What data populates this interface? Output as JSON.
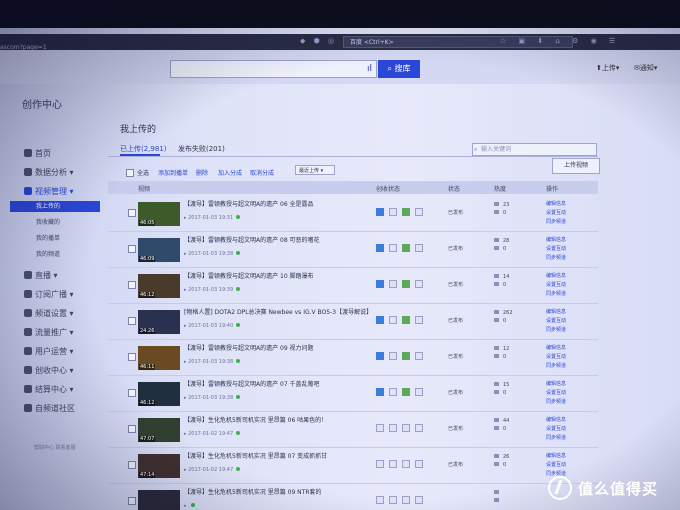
{
  "browser": {
    "url": "ascom?page=1",
    "search_box": "百度 <Ctrl+K>"
  },
  "header": {
    "search_button": "搜库",
    "upload": "上传",
    "notice": "通知"
  },
  "sidebar": {
    "title": "创作中心",
    "items": [
      {
        "label": "首页"
      },
      {
        "label": "数据分析"
      },
      {
        "label": "视频管理"
      },
      {
        "label": "直播"
      },
      {
        "label": "订阅广播"
      },
      {
        "label": "频道设置"
      },
      {
        "label": "流量推广"
      },
      {
        "label": "用户运营"
      },
      {
        "label": "创收中心"
      },
      {
        "label": "结算中心"
      },
      {
        "label": "自频道社区"
      }
    ],
    "sub_items": [
      {
        "label": "我上传的"
      },
      {
        "label": "我收藏的"
      },
      {
        "label": "我的播单"
      },
      {
        "label": "我的频道"
      }
    ],
    "footer": "帮助中心  联系客服"
  },
  "main": {
    "page_title": "我上传的",
    "search_placeholder": "输入关键词",
    "tabs": [
      {
        "label": "已上传(2,981)"
      },
      {
        "label": "发布失败(201)"
      }
    ],
    "toolbar": {
      "select_all": "全选",
      "add_to_playlist": "添加到播单",
      "delete": "删除",
      "add_category": "加入分成",
      "cancel_category": "取消分成",
      "sort": "最近上传",
      "upload_video": "上传视频"
    },
    "columns": {
      "video": "视频",
      "revenue_status": "创收状态",
      "status": "状态",
      "heat": "热度",
      "actions": "操作"
    },
    "rows": [
      {
        "duration": "46:05",
        "title": "【渡导】雷顿教授与超文明A的遗产 06 全是露品",
        "date": "2017-01-03 19:31",
        "status": "已发布",
        "heat": [
          "23",
          "0"
        ],
        "ops": [
          "编辑信息",
          "设置互动",
          "同步频道"
        ]
      },
      {
        "duration": "46:09",
        "title": "【渡导】雷顿教授与超文明A的遗产 08 可恶的嗜花",
        "date": "2017-01-03 19:38",
        "status": "已发布",
        "heat": [
          "28",
          "0"
        ],
        "ops": [
          "编辑信息",
          "设置互动",
          "同步频道"
        ]
      },
      {
        "duration": "46:12",
        "title": "【渡导】雷顿教授与超文明A的遗产 10 脚踏瀑布",
        "date": "2017-01-03 19:39",
        "status": "已发布",
        "heat": [
          "14",
          "0"
        ],
        "ops": [
          "编辑信息",
          "设置互动",
          "同步频道"
        ]
      },
      {
        "duration": "24:26",
        "title": "[物格人置] DOTA2 DPL总决赛 Newbee vs IG.V BO5-3【渡导解说】",
        "date": "2017-01-03 19:40",
        "status": "已发布",
        "heat": [
          "262",
          "0"
        ],
        "ops": [
          "编辑信息",
          "设置互动",
          "同步频道"
        ]
      },
      {
        "duration": "46:11",
        "title": "【渡导】雷顿教授与超文明A的遗产 09 视力问题",
        "date": "2017-01-03 19:38",
        "status": "已发布",
        "heat": [
          "12",
          "0"
        ],
        "ops": [
          "编辑信息",
          "设置互动",
          "同步频道"
        ]
      },
      {
        "duration": "46:12",
        "title": "【渡导】雷顿教授与超文明A的遗产 07 千盖乱葡吧",
        "date": "2017-01-03 19:38",
        "status": "已发布",
        "heat": [
          "15",
          "0"
        ],
        "ops": [
          "编辑信息",
          "设置互动",
          "同步频道"
        ]
      },
      {
        "duration": "47:07",
        "title": "【渡导】生化危机5新司机实况 里昂篇 06 咕果色的！",
        "date": "2017-01-02 19:47",
        "status": "已发布",
        "heat": [
          "44",
          "0"
        ],
        "ops": [
          "编辑信息",
          "设置互动",
          "同步频道"
        ]
      },
      {
        "duration": "47:14",
        "title": "【渡导】生化危机5新司机实况 里昂篇 07 变成抓抓甘",
        "date": "2017-01-02 19:47",
        "status": "已发布",
        "heat": [
          "26",
          "0"
        ],
        "ops": [
          "编辑信息",
          "设置互动",
          "同步频道"
        ]
      },
      {
        "duration": "",
        "title": "【渡导】生化危机5新司机实况 里昂篇 09 NTR套的",
        "date": "",
        "status": "",
        "heat": [
          "",
          ""
        ],
        "ops": [
          "",
          "",
          ""
        ]
      }
    ]
  },
  "watermark": "值么值得买"
}
